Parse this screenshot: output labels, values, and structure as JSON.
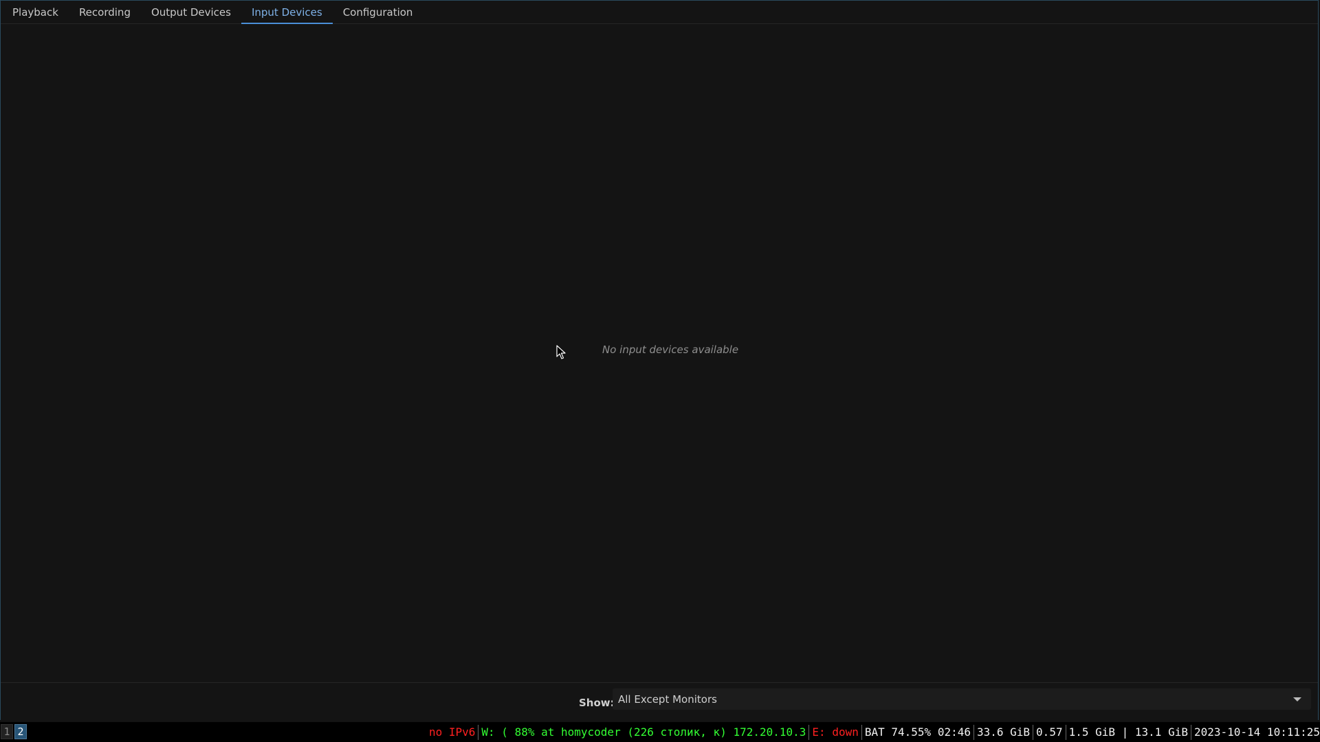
{
  "tabs": [
    {
      "label": "Playback",
      "active": false
    },
    {
      "label": "Recording",
      "active": false
    },
    {
      "label": "Output Devices",
      "active": false
    },
    {
      "label": "Input Devices",
      "active": true
    },
    {
      "label": "Configuration",
      "active": false
    }
  ],
  "main": {
    "empty_message": "No input devices available"
  },
  "footer": {
    "show_label": "Show:",
    "show_value": "All Except Monitors"
  },
  "workspaces": [
    "1",
    "2"
  ],
  "status": {
    "ipv6": "no IPv6",
    "wireless": "W: ( 88% at homycoder (226 столик, к) 172.20.10.3",
    "ethernet": "E: down",
    "battery": "BAT 74.55% 02:46",
    "disk": "33.6 GiB",
    "load": "0.57",
    "memory": "1.5 GiB | 13.1 GiB",
    "datetime": "2023-10-14 10:11:25"
  },
  "colors": {
    "accent": "#4a8fd8",
    "status_bad": "#ff2020",
    "status_good": "#33ff33"
  }
}
